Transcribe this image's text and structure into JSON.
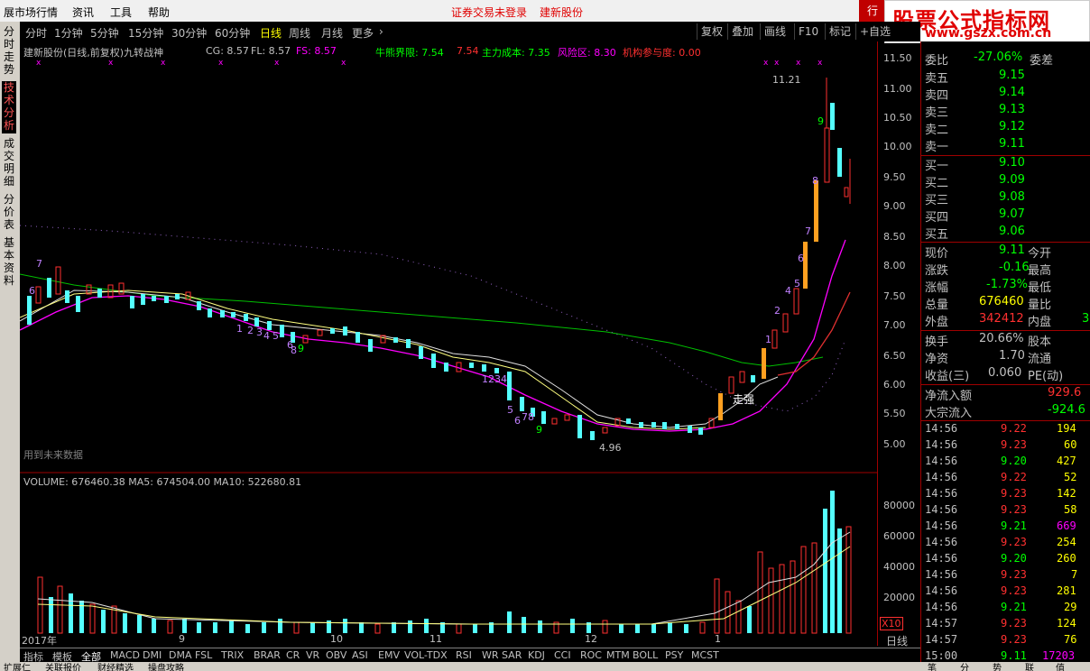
{
  "menu": {
    "items": [
      "展市场行情",
      "资讯",
      "工具",
      "帮助"
    ],
    "status_login": "证券交易未登录",
    "stock_name": "建新股份",
    "topright_btn": "行"
  },
  "watermark": {
    "line1": "股票公式指标网",
    "line2": "www.gszx.com.cn"
  },
  "tabs": [
    "分时",
    "1分钟",
    "5分钟",
    "15分钟",
    "30分钟",
    "60分钟",
    "日线",
    "周线",
    "月线",
    "更多"
  ],
  "active_tab": "日线",
  "toolbar": [
    "复权",
    "叠加",
    "画线",
    "F10",
    "标记",
    "+自选"
  ],
  "leftnav": [
    "分时走势",
    "技术分析",
    "成交明细",
    "分价表",
    "基本资料"
  ],
  "info": {
    "title": "建新股份(日线,前复权)九转战神",
    "cg": "CG: 8.57",
    "fl": "FL: 8.57",
    "fs": "FS: 8.57",
    "niuxiong": "牛熊界限: 7.54",
    "niuxiong2": "7.54",
    "zhuli": "主力成本: 7.35",
    "fengxian": "风险区: 8.30",
    "jigou": "机构参与度: 0.00"
  },
  "chart_labels": {
    "high": "11.21",
    "low": "4.96",
    "zouqiang": "走强",
    "future_note": "用到未来数据",
    "year": "2017年",
    "months": [
      "9",
      "10",
      "11",
      "12",
      "1"
    ]
  },
  "price_axis": [
    "11.50",
    "11.00",
    "10.50",
    "10.00",
    "9.50",
    "9.00",
    "8.50",
    "8.00",
    "7.50",
    "7.00",
    "6.50",
    "6.00",
    "5.50",
    "5.00"
  ],
  "volume": {
    "info": "VOLUME: 676460.38  MA5: 674504.00  MA10: 522680.81",
    "axis": [
      "80000",
      "60000",
      "40000",
      "20000"
    ],
    "unit": "X10"
  },
  "quote": {
    "weibi_label": "委比",
    "weibi": "-27.06%",
    "weicha_label": "委差",
    "asks": [
      [
        "卖五",
        "9.15"
      ],
      [
        "卖四",
        "9.14"
      ],
      [
        "卖三",
        "9.13"
      ],
      [
        "卖二",
        "9.12"
      ],
      [
        "卖一",
        "9.11"
      ]
    ],
    "bids": [
      [
        "买一",
        "9.10"
      ],
      [
        "买二",
        "9.09"
      ],
      [
        "买三",
        "9.08"
      ],
      [
        "买四",
        "9.07"
      ],
      [
        "买五",
        "9.06"
      ]
    ],
    "rows": [
      [
        "现价",
        "9.11",
        "今开",
        ""
      ],
      [
        "涨跌",
        "-0.16",
        "最高",
        ""
      ],
      [
        "涨幅",
        "-1.73%",
        "最低",
        ""
      ],
      [
        "总量",
        "676460",
        "量比",
        ""
      ],
      [
        "外盘",
        "342412",
        "内盘",
        "3"
      ]
    ],
    "rows2": [
      [
        "换手",
        "20.66%",
        "股本"
      ],
      [
        "净资",
        "1.70",
        "流通"
      ],
      [
        "收益(三)",
        "0.060",
        "PE(动)"
      ]
    ],
    "flow": [
      [
        "净流入额",
        "929.6"
      ],
      [
        "大宗流入",
        "-924.6"
      ]
    ]
  },
  "ticks": [
    [
      "14:56",
      "9.22",
      "194"
    ],
    [
      "14:56",
      "9.23",
      "60"
    ],
    [
      "14:56",
      "9.20",
      "427"
    ],
    [
      "14:56",
      "9.22",
      "52"
    ],
    [
      "14:56",
      "9.23",
      "142"
    ],
    [
      "14:56",
      "9.23",
      "58"
    ],
    [
      "14:56",
      "9.21",
      "669"
    ],
    [
      "14:56",
      "9.23",
      "254"
    ],
    [
      "14:56",
      "9.20",
      "260"
    ],
    [
      "14:56",
      "9.23",
      "7"
    ],
    [
      "14:56",
      "9.23",
      "281"
    ],
    [
      "14:56",
      "9.21",
      "29"
    ],
    [
      "14:57",
      "9.23",
      "124"
    ],
    [
      "14:57",
      "9.23",
      "76"
    ],
    [
      "15:00",
      "9.11",
      "17203"
    ]
  ],
  "period_label": "日线",
  "indicators": [
    "指标",
    "模板",
    "全部",
    "MACD",
    "DMI",
    "DMA",
    "FSL",
    "TRIX",
    "BRAR",
    "CR",
    "VR",
    "OBV",
    "ASI",
    "EMV",
    "VOL-TDX",
    "RSI",
    "WR",
    "SAR",
    "KDJ",
    "CCI",
    "ROC",
    "MTM",
    "BOLL",
    "PSY",
    "MCST"
  ],
  "bottom_tabs": [
    "扩展仁",
    "关联报价",
    "财经精选",
    "操盘攻略"
  ],
  "bottom_right": [
    "笔",
    "分",
    "势",
    "联",
    "值"
  ],
  "colors": {
    "up": "#ff3030",
    "down": "#54ffff",
    "yellow": "#ffff00",
    "green": "#00ff00",
    "magenta": "#ff00ff"
  }
}
